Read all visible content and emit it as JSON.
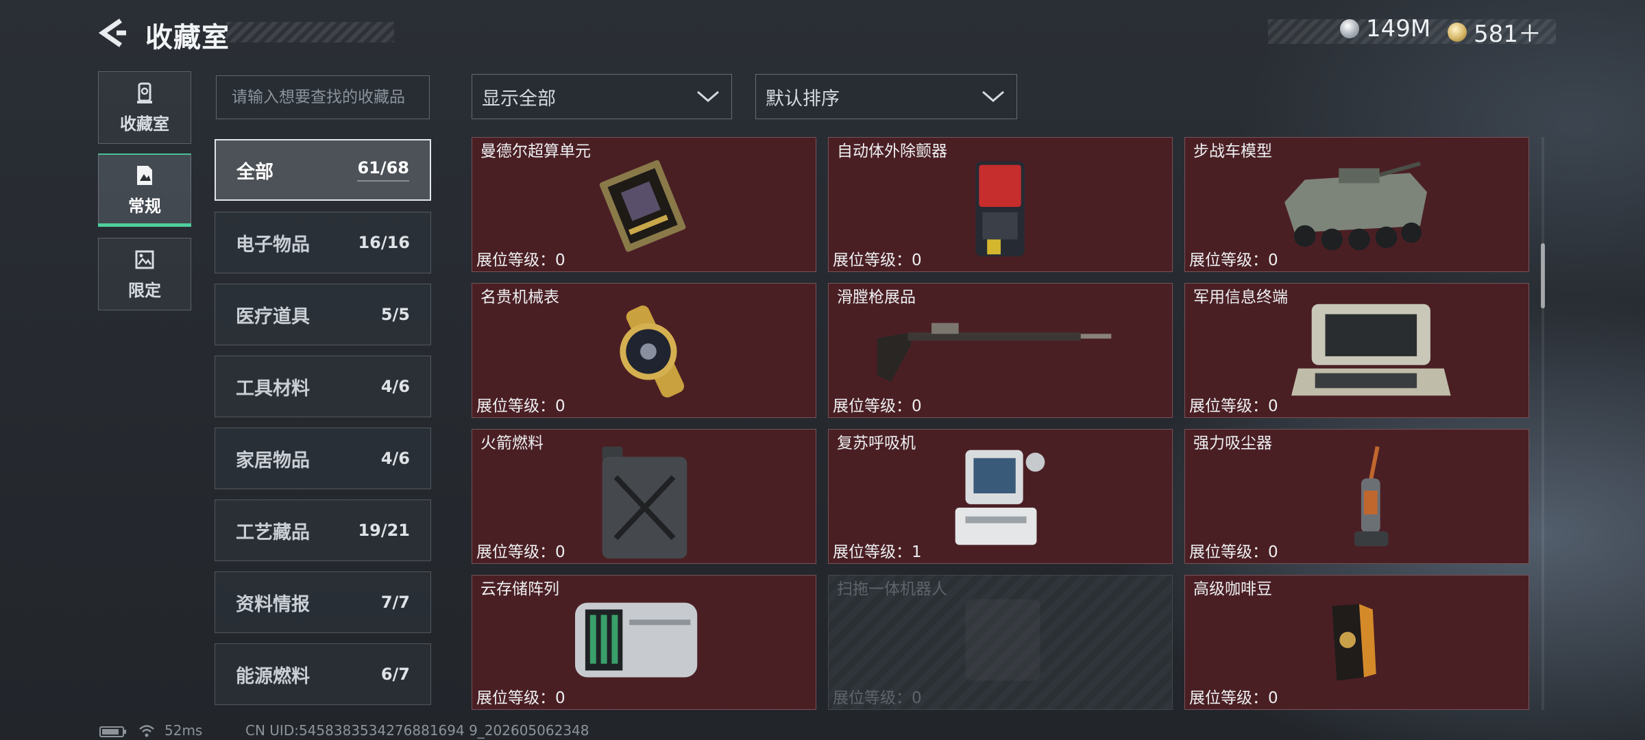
{
  "header": {
    "title": "收藏室",
    "currencies": [
      {
        "icon": "silver-coin-icon",
        "value": "149M"
      },
      {
        "icon": "gold-coin-icon",
        "value": "581＋"
      }
    ]
  },
  "nav": {
    "items": [
      {
        "label": "收藏室",
        "icon": "collection-icon",
        "active": false
      },
      {
        "label": "常规",
        "icon": "regular-icon",
        "active": true
      },
      {
        "label": "限定",
        "icon": "limited-icon",
        "active": false
      }
    ]
  },
  "search": {
    "placeholder": "请输入想要查找的收藏品",
    "value": ""
  },
  "filters": {
    "display": {
      "selected": "显示全部"
    },
    "sort": {
      "selected": "默认排序"
    }
  },
  "categories": [
    {
      "name": "全部",
      "count": "61/68",
      "active": true
    },
    {
      "name": "电子物品",
      "count": "16/16"
    },
    {
      "name": "医疗道具",
      "count": "5/5"
    },
    {
      "name": "工具材料",
      "count": "4/6"
    },
    {
      "name": "家居物品",
      "count": "4/6"
    },
    {
      "name": "工艺藏品",
      "count": "19/21"
    },
    {
      "name": "资料情报",
      "count": "7/7"
    },
    {
      "name": "能源燃料",
      "count": "6/7"
    }
  ],
  "items": [
    {
      "name": "曼德尔超算单元",
      "level": "展位等级：0",
      "icon": "mandel-supercomputer-unit-icon"
    },
    {
      "name": "自动体外除颤器",
      "level": "展位等级：0",
      "icon": "defibrillator-icon"
    },
    {
      "name": "步战车模型",
      "level": "展位等级：0",
      "icon": "ifv-model-icon"
    },
    {
      "name": "名贵机械表",
      "level": "展位等级：0",
      "icon": "luxury-watch-icon"
    },
    {
      "name": "滑膛枪展品",
      "level": "展位等级：0",
      "icon": "musket-icon"
    },
    {
      "name": "军用信息终端",
      "level": "展位等级：0",
      "icon": "military-terminal-icon"
    },
    {
      "name": "火箭燃料",
      "level": "展位等级：0",
      "icon": "fuel-can-icon"
    },
    {
      "name": "复苏呼吸机",
      "level": "展位等级：1",
      "icon": "ventilator-icon"
    },
    {
      "name": "强力吸尘器",
      "level": "展位等级：0",
      "icon": "vacuum-cleaner-icon"
    },
    {
      "name": "云存储阵列",
      "level": "展位等级：0",
      "icon": "cloud-storage-array-icon"
    },
    {
      "name": "扫拖一体机器人",
      "level": "展位等级：0",
      "icon": "robot-vacuum-icon",
      "locked": true
    },
    {
      "name": "高级咖啡豆",
      "level": "展位等级：0",
      "icon": "coffee-beans-icon"
    }
  ],
  "status": {
    "ping": "52ms",
    "uid": "CN UID:5458383534276881694 9_202605062348"
  },
  "colors": {
    "card_bg": "#4a1f24",
    "active_accent": "#4fcf9e",
    "background": "#262a30"
  }
}
